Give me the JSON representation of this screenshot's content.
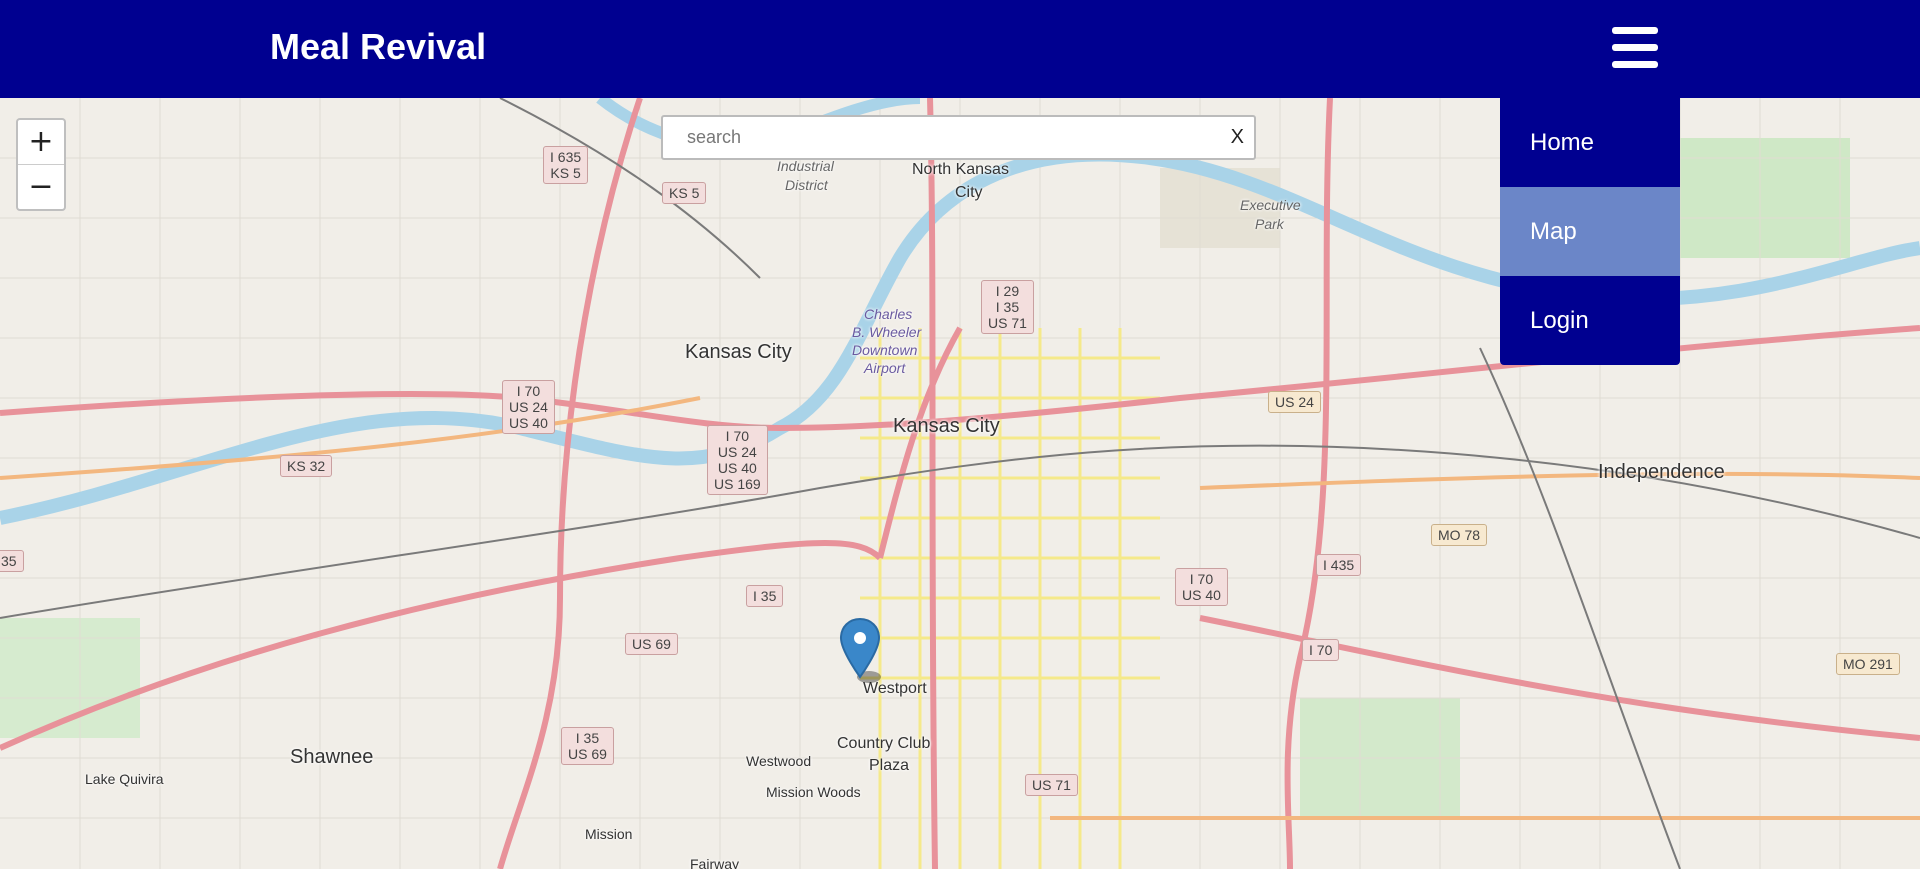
{
  "header": {
    "brand": "Meal Revival"
  },
  "menu": {
    "items": [
      {
        "label": "Home",
        "active": false
      },
      {
        "label": "Map",
        "active": true
      },
      {
        "label": "Login",
        "active": false
      }
    ]
  },
  "search": {
    "placeholder": "search",
    "value": "",
    "clear_label": "X"
  },
  "zoom": {
    "in_label": "+",
    "out_label": "−"
  },
  "colors": {
    "header": "#000090",
    "menu_active": "#6b86c8",
    "marker": "#3a87c9",
    "river": "#a9d3e8"
  },
  "map": {
    "labels": {
      "kansas_city_main": "Kansas City",
      "kansas_city_ks": "Kansas City",
      "north_kansas_city_1": "North Kansas",
      "north_kansas_city_2": "City",
      "independence": "Independence",
      "shawnee": "Shawnee",
      "westport": "Westport",
      "country_club_1": "Country Club",
      "country_club_2": "Plaza",
      "westwood": "Westwood",
      "mission_woods": "Mission Woods",
      "mission": "Mission",
      "lake_quivira": "Lake Quivira",
      "industrial_1": "Industrial",
      "industrial_2": "District",
      "executive_1": "Executive",
      "executive_2": "Park",
      "airport_1": "Charles",
      "airport_2": "B. Wheeler",
      "airport_3": "Downtown",
      "airport_4": "Airport",
      "fairway": "Fairway"
    },
    "shields": {
      "i635": "I 635\nKS 5",
      "ks5": "KS 5",
      "i29": "I 29\nI 35\nUS 71",
      "i70_us24_us40_w": "I 70\nUS 24\nUS 40",
      "i70_us24_us40_us169": "I 70\nUS 24\nUS 40\nUS 169",
      "ks32": "KS 32",
      "us24": "US 24",
      "mo78": "MO 78",
      "i435": "I 435",
      "i70_us40_e": "I 70\nUS 40",
      "i70": "I 70",
      "i35": "I 35",
      "us69": "US 69",
      "i35_us69": "I 35\nUS 69",
      "us71": "US 71",
      "mo291": "MO 291",
      "edge35": "35"
    }
  }
}
